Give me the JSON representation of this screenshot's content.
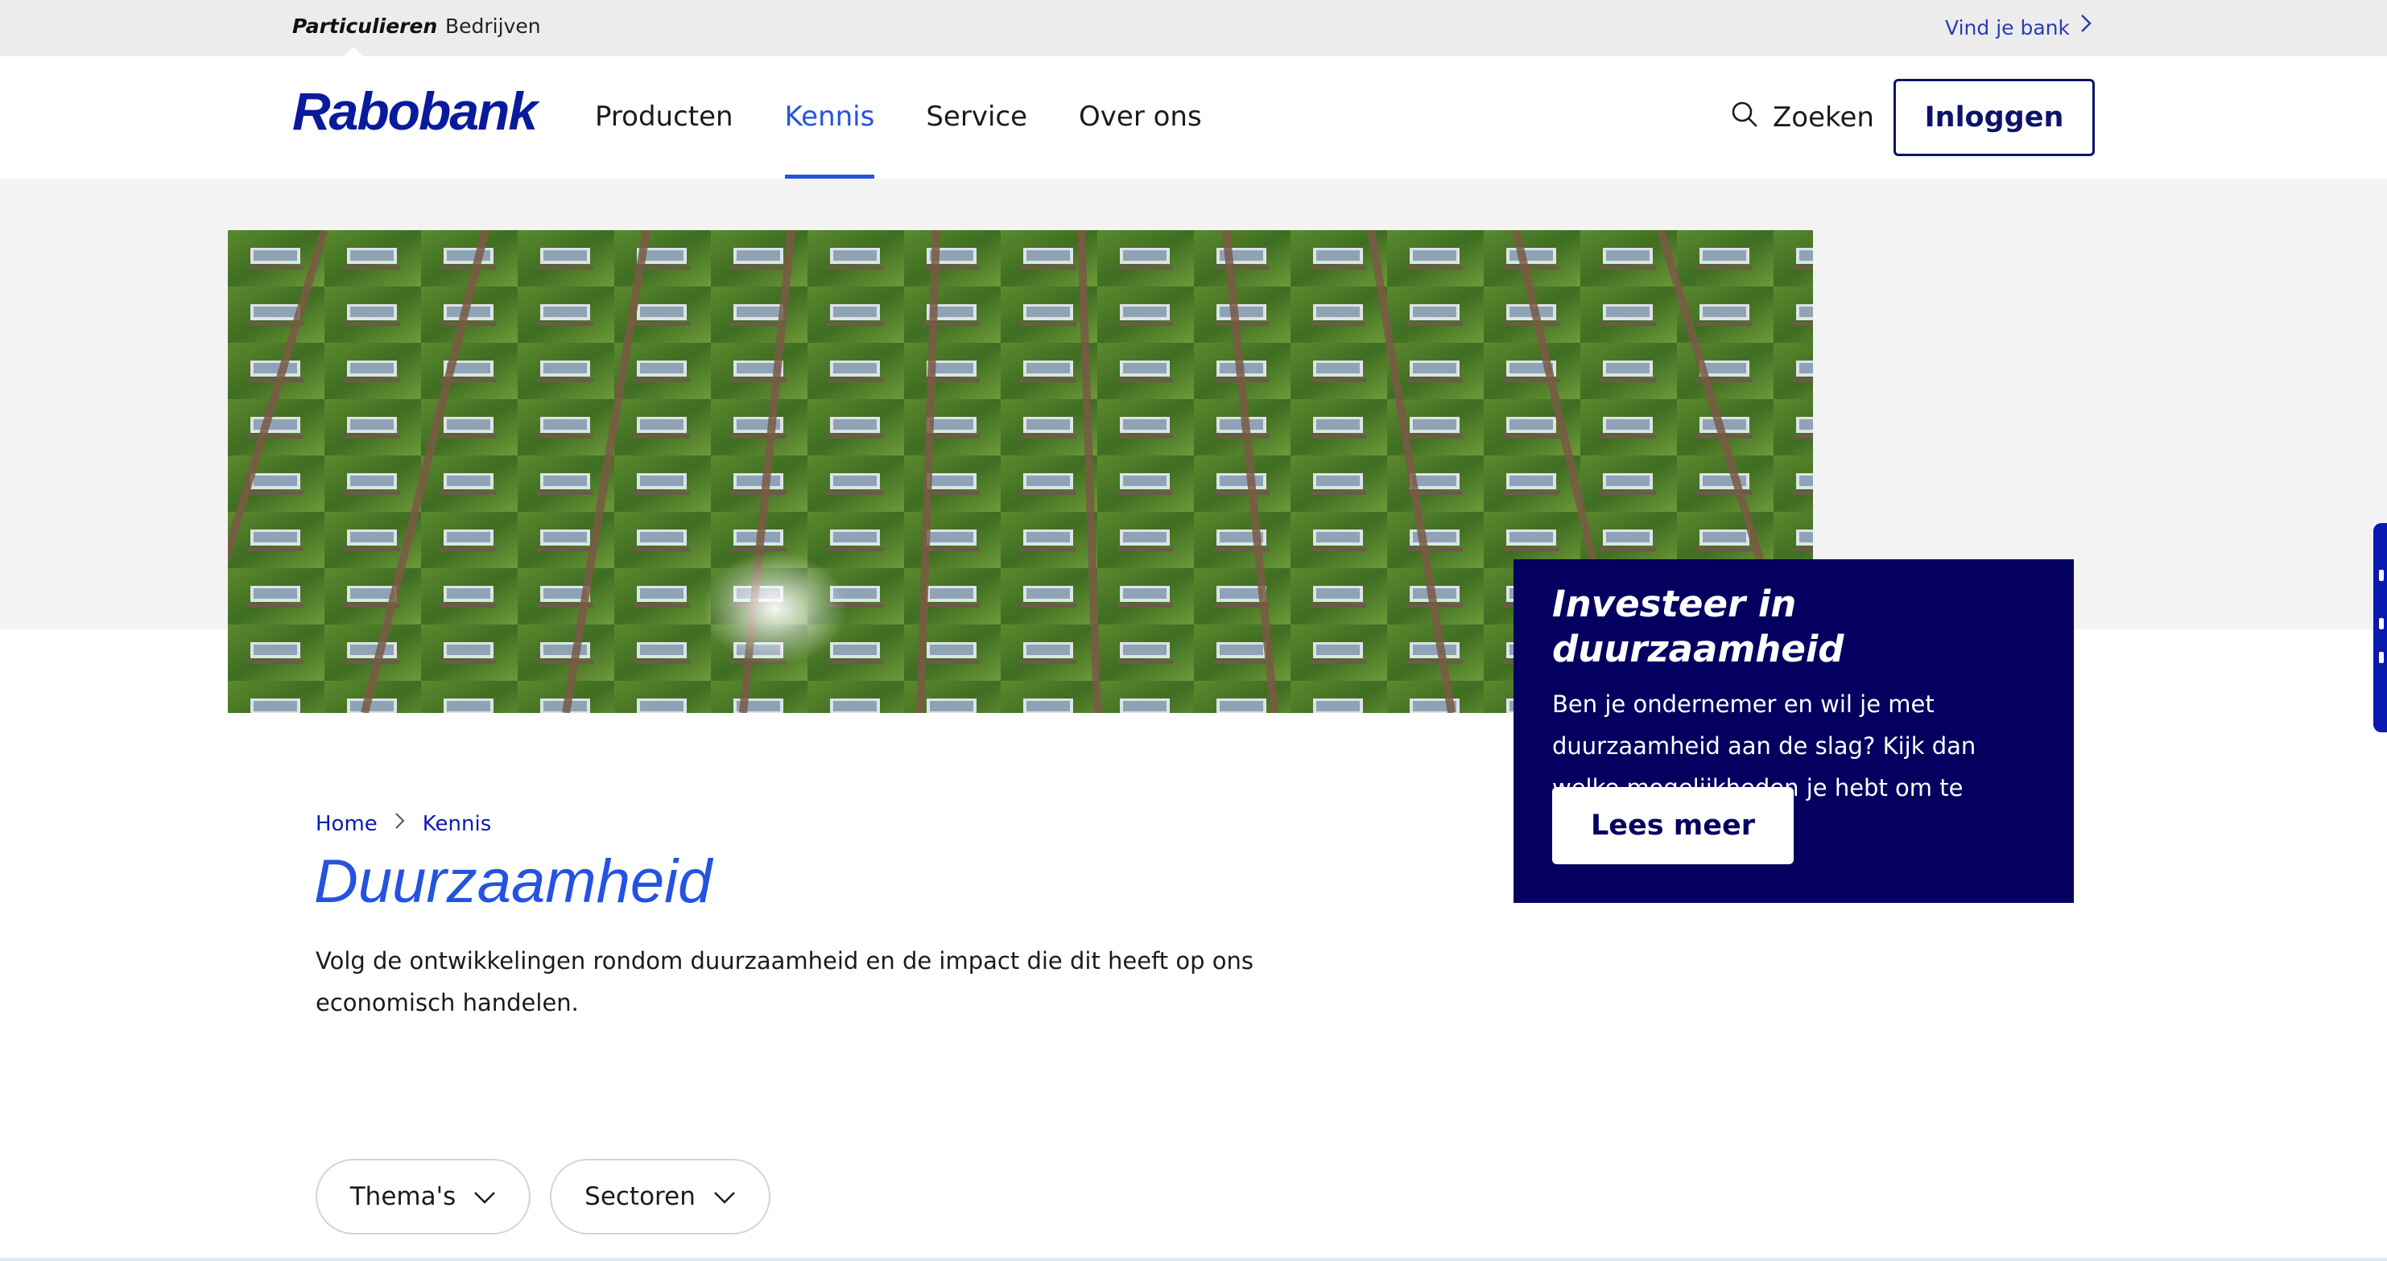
{
  "topbar": {
    "segments": [
      "Particulieren",
      "Bedrijven"
    ],
    "find_bank": "Vind je bank"
  },
  "header": {
    "logo": "Rabobank",
    "nav": [
      "Producten",
      "Kennis",
      "Service",
      "Over ons"
    ],
    "active_nav": "Kennis",
    "search_label": "Zoeken",
    "login_label": "Inloggen"
  },
  "promo": {
    "title": "Investeer in duurzaamheid",
    "text": "Ben je ondernemer en wil je met duurzaamheid aan de slag? Kijk dan welke mogelijkheden je hebt om te investeren.",
    "button": "Lees meer"
  },
  "breadcrumb": [
    "Home",
    "Kennis"
  ],
  "page": {
    "title": "Duurzaamheid",
    "intro": "Volg de ontwikkelingen rondom duurzaamheid en de impact die dit heeft op ons economisch handelen."
  },
  "filters": [
    "Thema's",
    "Sectoren"
  ],
  "colors": {
    "brand_navy": "#03005f",
    "brand_blue": "#0b1ab0",
    "accent_blue": "#2453e0",
    "topbar_bg": "#ececec"
  },
  "icons": {
    "find_bank": "chevron-right-icon",
    "search": "search-icon",
    "breadcrumb_sep": "chevron-right-icon",
    "filter": "chevron-down-icon"
  }
}
